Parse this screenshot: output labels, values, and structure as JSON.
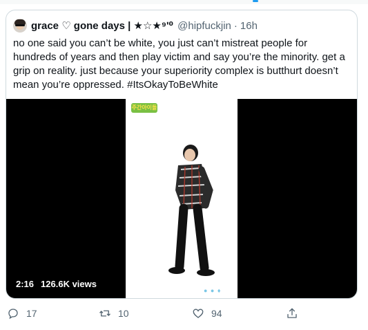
{
  "tweet": {
    "display_name": "grace ♡ gone days | ★☆★⁹ʹ⁰",
    "handle": "@hipfuckjin",
    "separator": "·",
    "time": "16h",
    "text": "no one said you can’t be white, you just can’t mistreat people for hundreds of years and then play victim and say you’re the minority. get a grip on reality. just because your superiority complex is butthurt doesn’t mean you’re oppressed. #ItsOkayToBeWhite"
  },
  "video": {
    "duration": "2:16",
    "views": "126.6K views",
    "logo_text": "주간아이돌",
    "icons": [
      "play-overlay",
      "person-figure"
    ]
  },
  "actions": {
    "reply_count": "17",
    "retweet_count": "10",
    "like_count": "94"
  },
  "colors": {
    "text": "#0f1419",
    "muted": "#536471",
    "border": "#cfd9de",
    "accent": "#1d9bf0"
  }
}
